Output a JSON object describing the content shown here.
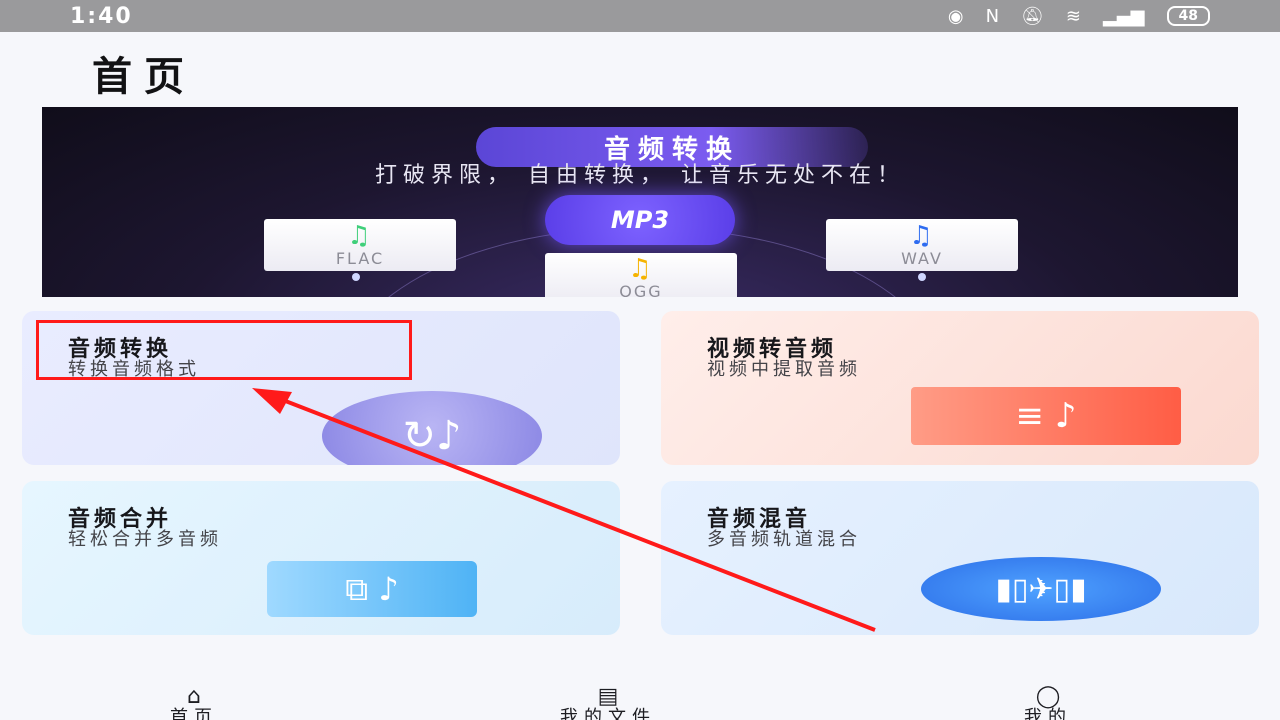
{
  "status_bar": {
    "time": "1:40",
    "battery": "48",
    "icons": [
      "eye-icon",
      "nfc-icon",
      "mute-icon",
      "wifi-icon",
      "signal-icon",
      "battery-icon"
    ]
  },
  "page_title": "首页",
  "banner": {
    "title": "音频转换",
    "subtitle": "打破界限， 自由转换， 让音乐无处不在！",
    "center_format": "MP3",
    "formats": {
      "flac": "FLAC",
      "ogg": "OGG",
      "wav": "WAV"
    }
  },
  "cards": [
    {
      "title": "音频转换",
      "desc": "转换音频格式"
    },
    {
      "title": "视频转音频",
      "desc": "视频中提取音频"
    },
    {
      "title": "音频合并",
      "desc": "轻松合并多音频"
    },
    {
      "title": "音频混音",
      "desc": "多音频轨道混合"
    }
  ],
  "bottom_nav": [
    {
      "label": "首页"
    },
    {
      "label": "我的文件"
    },
    {
      "label": "我的"
    }
  ],
  "colors": {
    "highlight": "#ff1a1a",
    "accent": "#6a4ff0"
  }
}
